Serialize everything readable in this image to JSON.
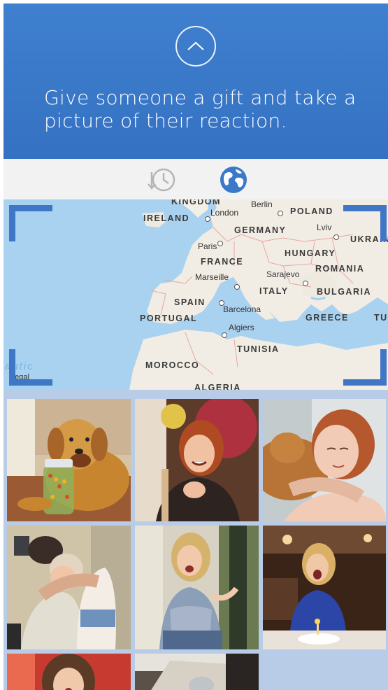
{
  "header": {
    "tagline": "Give someone a gift and take a picture of their reaction."
  },
  "toolbar": {
    "history_icon": "history-clock-icon",
    "globe_icon": "globe-icon"
  },
  "map": {
    "legal": "Legal",
    "ocean_label": "antic",
    "countries": [
      "KINGDOM",
      "IRELAND",
      "POLAND",
      "GERMANY",
      "UKRAIN",
      "FRANCE",
      "HUNGARY",
      "ROMANIA",
      "ITALY",
      "BULGARIA",
      "SPAIN",
      "PORTUGAL",
      "GREECE",
      "TU",
      "TUNISIA",
      "MOROCCO",
      "ALGERIA"
    ],
    "cities": [
      "London",
      "Berlin",
      "Lviv",
      "Paris",
      "Marseille",
      "Sarajevo",
      "Barcelona",
      "Algiers"
    ]
  },
  "photos": [
    {
      "label": "dog-photo"
    },
    {
      "label": "woman-laughing-photo"
    },
    {
      "label": "cat-hug-photo"
    },
    {
      "label": "hug-photo"
    },
    {
      "label": "excited-girl-photo"
    },
    {
      "label": "birthday-surprise-photo"
    },
    {
      "label": "surprised-girl-photo"
    },
    {
      "label": "kitten-box-photo"
    }
  ]
}
